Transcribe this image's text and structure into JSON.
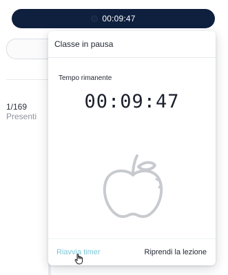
{
  "top_timer": {
    "time": "00:09:47",
    "icon": "clock-icon"
  },
  "background": {
    "attendance_count": "1/169",
    "attendance_label": "Presenti"
  },
  "modal": {
    "title": "Classe in pausa",
    "remaining_label": "Tempo rimanente",
    "time_remaining": "00:09:47",
    "illustration": "apple-icon",
    "restart_button": "Riavvia timer",
    "resume_button": "Riprendi la lezione"
  },
  "colors": {
    "pill_bg": "#0f1f3e",
    "link": "#7dc8d8",
    "apple_stroke": "#c7cace"
  }
}
